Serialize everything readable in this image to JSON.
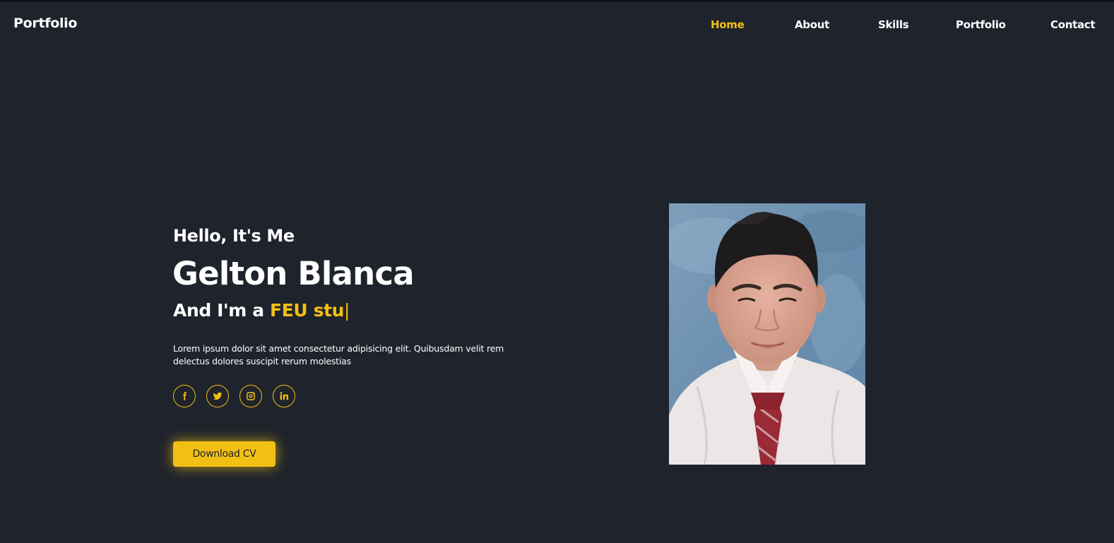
{
  "header": {
    "logo": "Portfolio",
    "nav": [
      {
        "label": "Home",
        "active": true
      },
      {
        "label": "About",
        "active": false
      },
      {
        "label": "Skills",
        "active": false
      },
      {
        "label": "Portfolio",
        "active": false
      },
      {
        "label": "Contact",
        "active": false
      }
    ]
  },
  "hero": {
    "greeting": "Hello, It's Me",
    "name": "Gelton Blanca",
    "role_prefix": "And I'm a ",
    "role_typed": "FEU stu",
    "caret": "|",
    "description": "Lorem ipsum dolor sit amet consectetur adipisicing elit. Quibusdam velit rem delectus dolores suscipit rerum molestias",
    "social_icons": [
      "facebook-icon",
      "twitter-icon",
      "instagram-icon",
      "linkedin-icon"
    ],
    "cv_button": "Download CV"
  },
  "colors": {
    "background": "#1f232c",
    "accent": "#f2c014",
    "text": "#ffffff"
  }
}
